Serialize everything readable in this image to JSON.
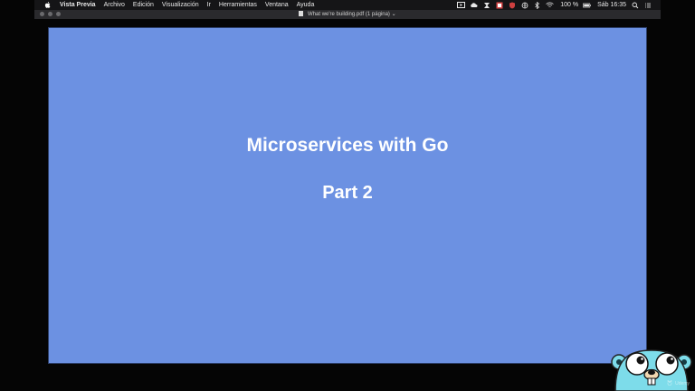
{
  "menubar": {
    "app_name": "Vista Previa",
    "items": [
      "Archivo",
      "Edición",
      "Visualización",
      "Ir",
      "Herramientas",
      "Ventana",
      "Ayuda"
    ],
    "battery": "100 %",
    "clock": "Sáb 16:35"
  },
  "window": {
    "title": "What we're building.pdf (1 página)"
  },
  "slide": {
    "title": "Microservices with Go",
    "subtitle": "Part 2"
  },
  "watermark": {
    "text": "Udemy"
  },
  "colors": {
    "slide_background": "#6c91e2",
    "gopher": "#7ddcea",
    "menu_background": "#151517"
  },
  "icons": [
    "apple-icon",
    "screen-record-icon",
    "cloud-icon",
    "app-icon",
    "app-square-icon",
    "shield-icon",
    "globe-icon",
    "bluetooth-icon",
    "wifi-icon",
    "battery-icon",
    "search-icon",
    "list-icon",
    "document-icon",
    "gopher-icon"
  ]
}
